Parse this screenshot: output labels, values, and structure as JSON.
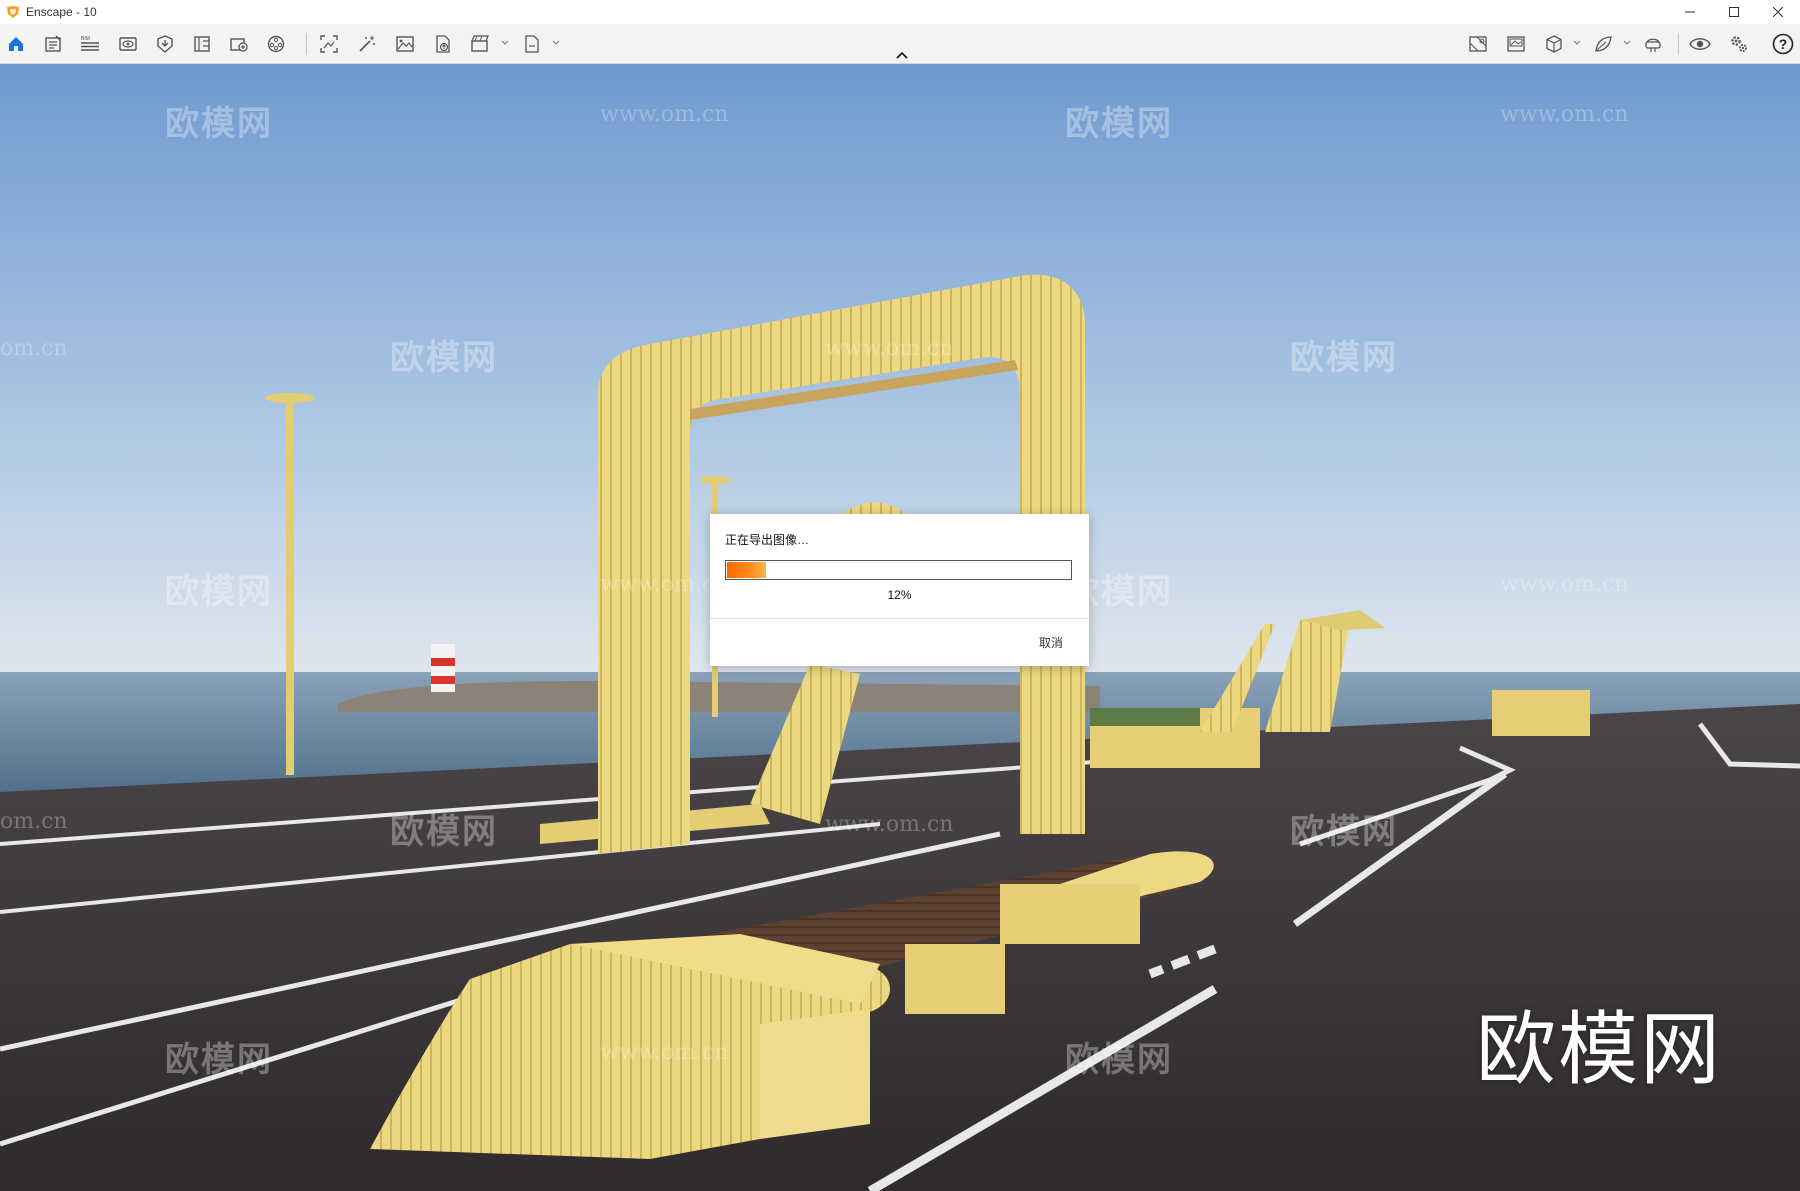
{
  "window": {
    "title": "Enscape - 10"
  },
  "toolbar": {
    "left_icons": [
      "home-icon",
      "project-notes-icon",
      "bim-icon",
      "views-icon",
      "asset-library-icon",
      "material-editor-icon",
      "batch-render-icon",
      "panorama-icon",
      "screenshot-icon",
      "magic-wand-icon",
      "render-image-icon",
      "upload-icon",
      "video-export-icon",
      "export-file-icon"
    ],
    "right_icons": [
      "map-view-icon",
      "gallery-icon",
      "cube-view-icon",
      "leaf-icon",
      "vr-headset-icon",
      "visibility-icon",
      "settings-icon",
      "help-icon"
    ]
  },
  "viewport": {
    "watermark_text": "欧模网",
    "watermark_url": "www.om.cn",
    "watermark_url_partial": "om.cn",
    "logo_text": "欧模网"
  },
  "export_dialog": {
    "title": "正在导出图像…",
    "progress_percent": 12,
    "progress_label": "12%",
    "cancel_label": "取消",
    "progress_color": "#ff7a00"
  },
  "colors": {
    "accent": "#1a73e8",
    "structure_yellow": "#e8d47c",
    "asphalt": "#3b3638",
    "sky_top": "#7aa3d4",
    "sea": "#6f8aa3"
  }
}
